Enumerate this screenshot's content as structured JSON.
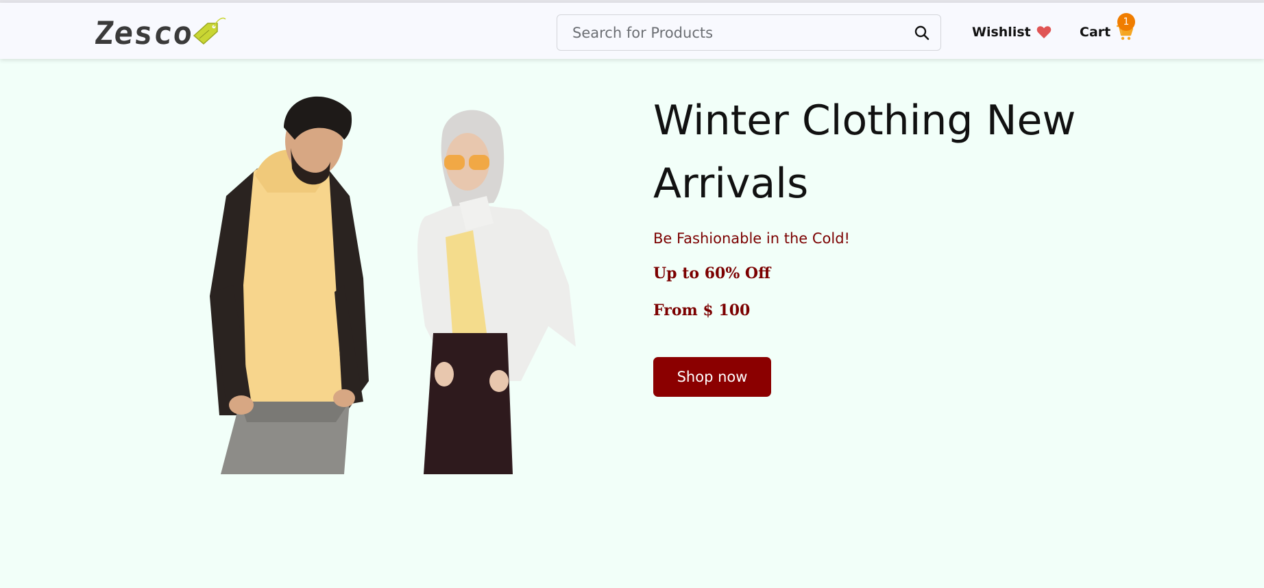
{
  "header": {
    "logo_text": "Zesco",
    "search": {
      "placeholder": "Search for Products",
      "value": "",
      "icon": "search-icon"
    },
    "wishlist": {
      "label": "Wishlist",
      "icon": "heart-icon",
      "icon_color": "#e05454"
    },
    "cart": {
      "label": "Cart",
      "icon": "shopping-cart-icon",
      "icon_color": "#f5a623",
      "count": "1",
      "badge_color": "#f07d00"
    }
  },
  "hero": {
    "title": "Winter Clothing New Arrivals",
    "subtitle": "Be Fashionable in the Cold!",
    "offer": "Up to 60% Off",
    "price": "From $ 100",
    "button_label": "Shop now",
    "accent_color": "#8b0000"
  },
  "colors": {
    "page_background": "#f2fff9",
    "header_background": "#f8f9fe"
  }
}
